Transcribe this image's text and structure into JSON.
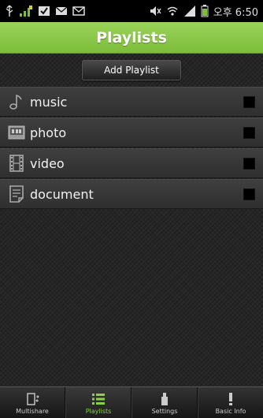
{
  "status_bar": {
    "time": "오후 6:50",
    "icons": [
      "usb-icon",
      "signal-bars-icon",
      "checkbox-icon",
      "mail-icon",
      "mail-icon",
      "mute-icon",
      "wifi-icon",
      "cell-signal-icon",
      "battery-icon"
    ]
  },
  "header": {
    "title": "Playlists"
  },
  "main": {
    "add_button": "Add Playlist",
    "items": [
      {
        "label": "music",
        "icon": "music-note-icon",
        "checked": false
      },
      {
        "label": "photo",
        "icon": "photo-icon",
        "checked": false
      },
      {
        "label": "video",
        "icon": "film-icon",
        "checked": false
      },
      {
        "label": "document",
        "icon": "document-icon",
        "checked": false
      }
    ]
  },
  "tabs": [
    {
      "label": "Multishare",
      "icon": "multishare-icon",
      "active": false
    },
    {
      "label": "Playlists",
      "icon": "list-icon",
      "active": true
    },
    {
      "label": "Settings",
      "icon": "settings-icon",
      "active": false
    },
    {
      "label": "Basic Info",
      "icon": "info-icon",
      "active": false
    }
  ],
  "colors": {
    "accent": "#8cd04a",
    "header_green": "#8ac84a"
  }
}
